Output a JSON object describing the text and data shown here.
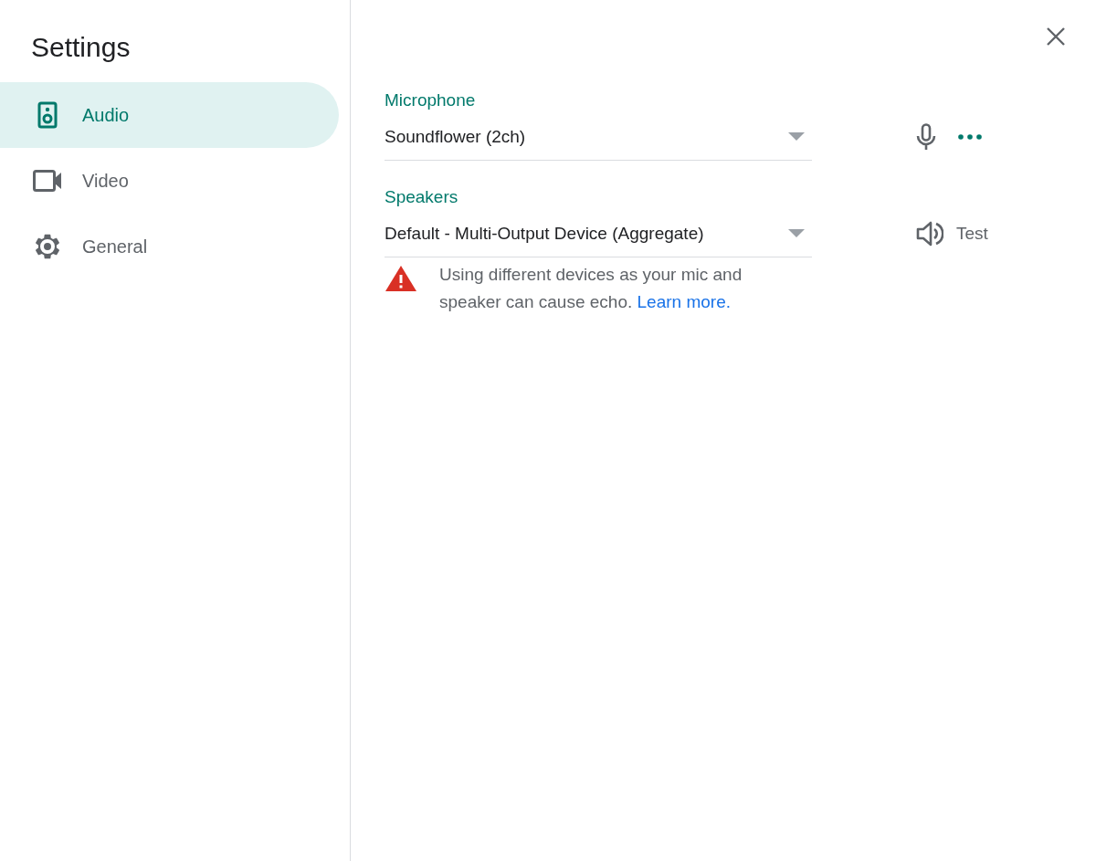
{
  "title": "Settings",
  "nav": [
    {
      "label": "Audio",
      "kind": "speaker",
      "selected": true
    },
    {
      "label": "Video",
      "kind": "camera",
      "selected": false
    },
    {
      "label": "General",
      "kind": "gear",
      "selected": false
    }
  ],
  "sections": [
    {
      "label": "Microphone",
      "value": "Soundflower (2ch)",
      "kind": "mic"
    },
    {
      "label": "Speakers",
      "value": "Default - Multi-Output Device (Aggregate)",
      "kind": "speaker",
      "action": "Test",
      "warning": {
        "text": "Using different devices as your mic and speaker can cause echo.",
        "link": "Learn more."
      }
    }
  ]
}
